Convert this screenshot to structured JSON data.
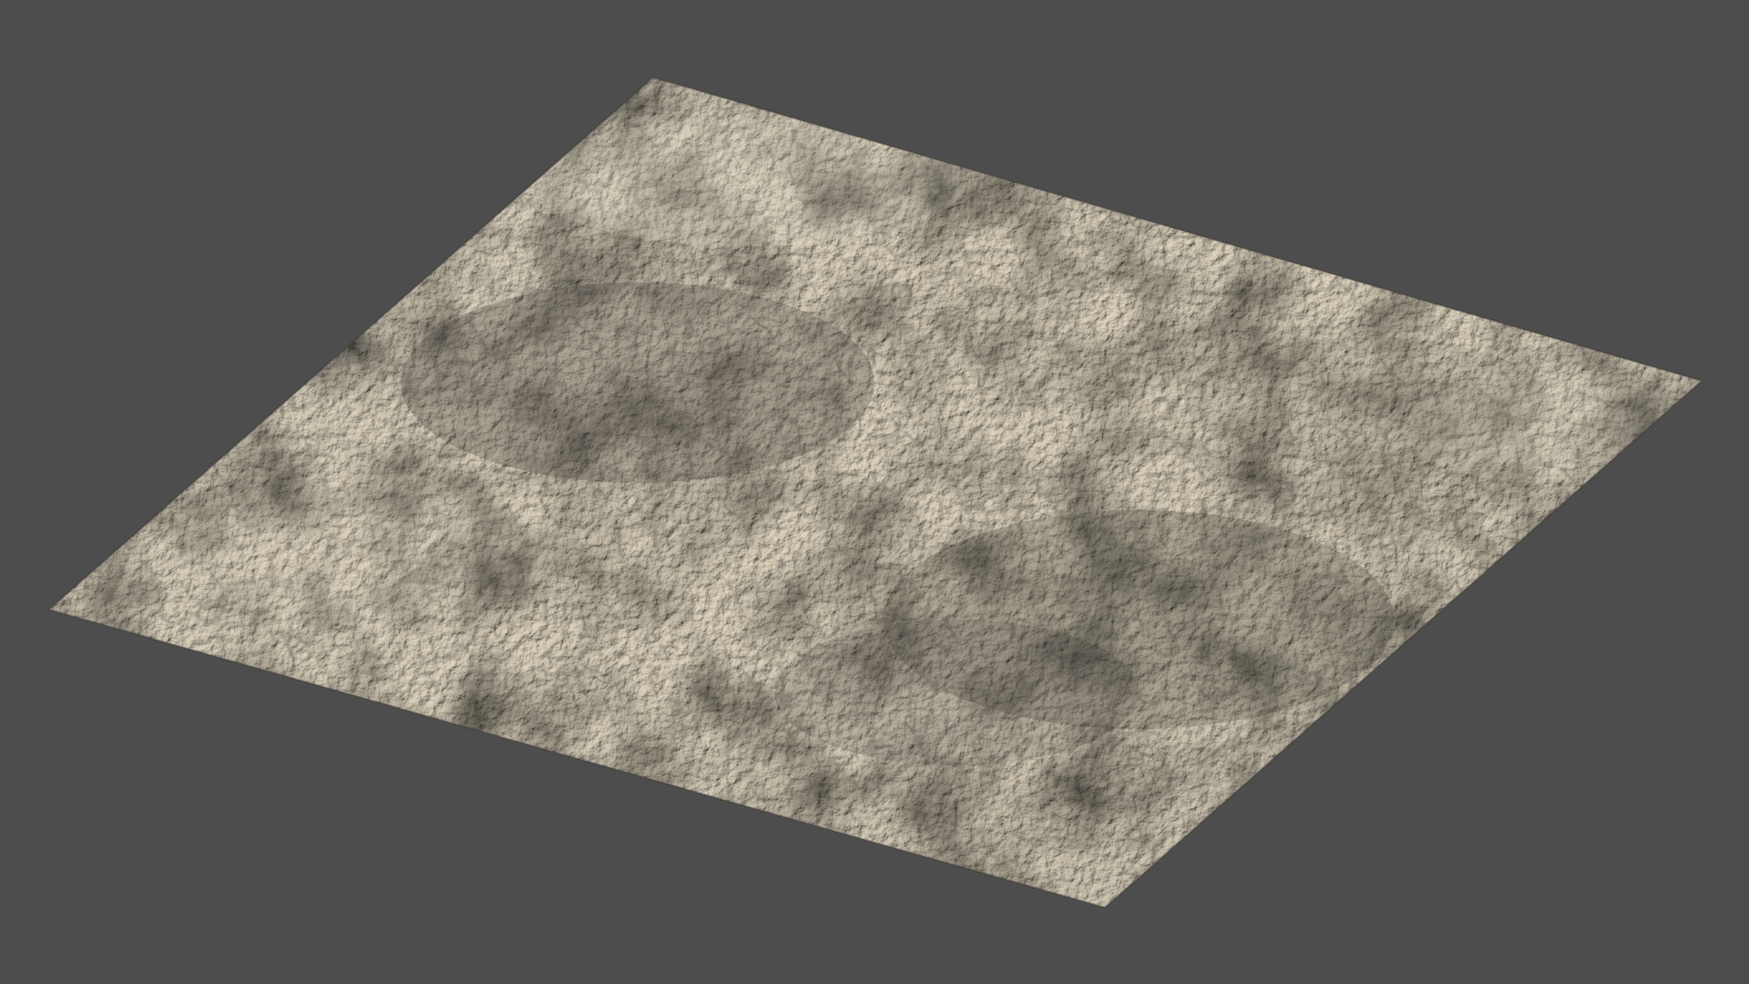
{
  "scene": {
    "background_color": "#4d4d4d",
    "object": "rock-texture-plane",
    "material": {
      "base_color": "#a39a88",
      "light_color": "#cfc6b2",
      "dark_color": "#4f4b44",
      "crack_color": "#3a362f"
    }
  }
}
